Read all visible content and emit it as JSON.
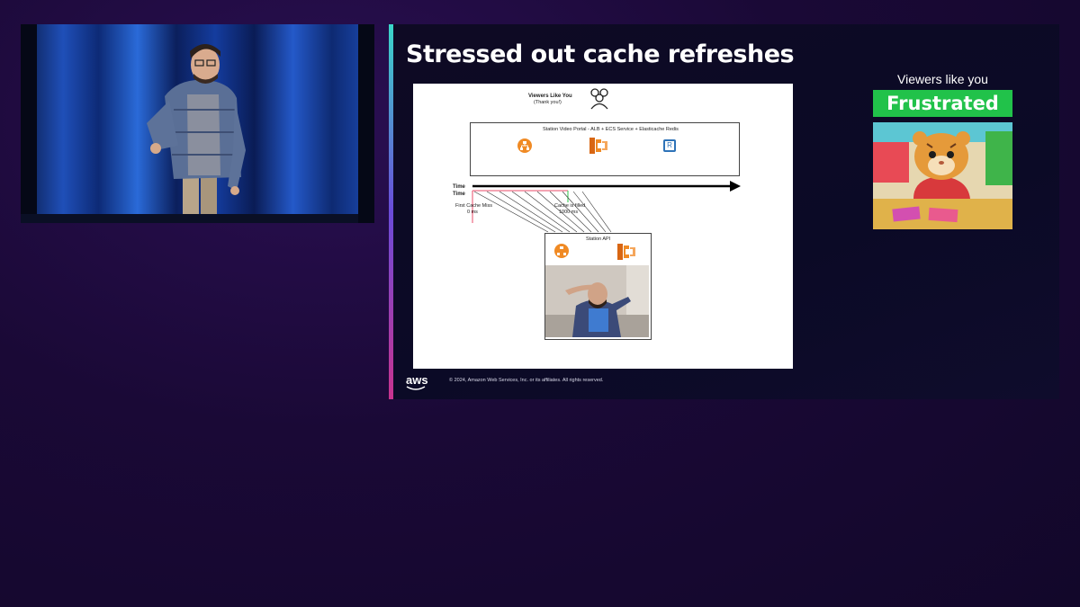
{
  "slide": {
    "title": "Stressed out cache refreshes",
    "footer": {
      "logo_text": "aws",
      "copyright": "© 2024, Amazon Web Services, Inc. or its affiliates. All rights reserved."
    }
  },
  "diagram": {
    "viewers_title": "Viewers Like You",
    "viewers_subtitle": "(Thank you!)",
    "portal_label": "Station Video Portal - ALB + ECS Service + Elasticache Redis",
    "time_label_1": "Time",
    "time_label_2": "Time",
    "first_miss_label": "First Cache Miss",
    "first_miss_time": "0 ms",
    "cache_filled_label": "Cache is filled",
    "cache_filled_time": "1000 ms",
    "api_label": "Station API",
    "redis_glyph": "R"
  },
  "reaction": {
    "viewers_label": "Viewers like you",
    "mood": "Frustrated"
  },
  "colors": {
    "background": "#1a0936",
    "badge_green": "#21c24a",
    "aws_orange": "#f08a24"
  },
  "icons": [
    "people-icon",
    "load-balancer-icon",
    "ecs-icon",
    "redis-icon",
    "aws-logo-icon"
  ]
}
